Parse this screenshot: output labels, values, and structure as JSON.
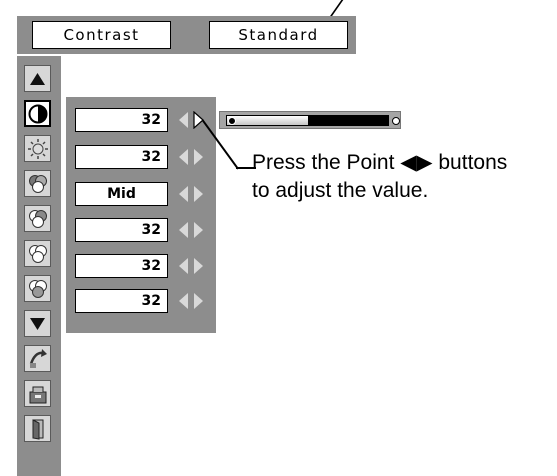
{
  "header": {
    "left_label": "Contrast",
    "right_label": "Standard"
  },
  "sidebar": {
    "icons": [
      "up-arrow-icon",
      "contrast-icon",
      "brightness-icon",
      "color-icon",
      "tint-icon",
      "white-balance-icon",
      "gamma-icon",
      "down-arrow-icon",
      "reset-icon",
      "store-icon",
      "exit-icon"
    ],
    "selected_index": 1
  },
  "adjustments": [
    {
      "value": "32"
    },
    {
      "value": "32"
    },
    {
      "value": "Mid"
    },
    {
      "value": "32"
    },
    {
      "value": "32"
    },
    {
      "value": "32"
    }
  ],
  "slider": {
    "level": 0.5
  },
  "instruction": {
    "line1": "Press the Point ◀▶ buttons",
    "line2": "to adjust the value."
  },
  "colors": {
    "panel_gray": "#8d8d8d",
    "arrow_light": "#d9d9d9"
  }
}
